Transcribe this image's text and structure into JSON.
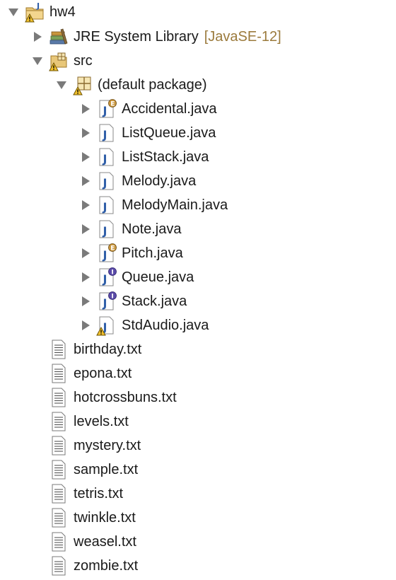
{
  "project": {
    "name": "hw4"
  },
  "library": {
    "name": "JRE System Library",
    "decoration": "[JavaSE-12]"
  },
  "src": {
    "name": "src"
  },
  "package": {
    "name": "(default package)"
  },
  "java_files": [
    {
      "name": "Accidental.java",
      "kind": "enum"
    },
    {
      "name": "ListQueue.java",
      "kind": "class"
    },
    {
      "name": "ListStack.java",
      "kind": "class"
    },
    {
      "name": "Melody.java",
      "kind": "class"
    },
    {
      "name": "MelodyMain.java",
      "kind": "class"
    },
    {
      "name": "Note.java",
      "kind": "class"
    },
    {
      "name": "Pitch.java",
      "kind": "enum"
    },
    {
      "name": "Queue.java",
      "kind": "interface"
    },
    {
      "name": "Stack.java",
      "kind": "interface"
    },
    {
      "name": "StdAudio.java",
      "kind": "class-warning"
    }
  ],
  "text_files": [
    {
      "name": "birthday.txt"
    },
    {
      "name": "epona.txt"
    },
    {
      "name": "hotcrossbuns.txt"
    },
    {
      "name": "levels.txt"
    },
    {
      "name": "mystery.txt"
    },
    {
      "name": "sample.txt"
    },
    {
      "name": "tetris.txt"
    },
    {
      "name": "twinkle.txt"
    },
    {
      "name": "weasel.txt"
    },
    {
      "name": "zombie.txt"
    }
  ],
  "colors": {
    "decoration": "#9b7a3c",
    "twisty": "#7a7a7a",
    "java_file_blue": "#2f5ea8",
    "warning_yellow": "#f2c12e",
    "enum_badge": "#c9963d",
    "interface_badge": "#5a4aa8"
  }
}
